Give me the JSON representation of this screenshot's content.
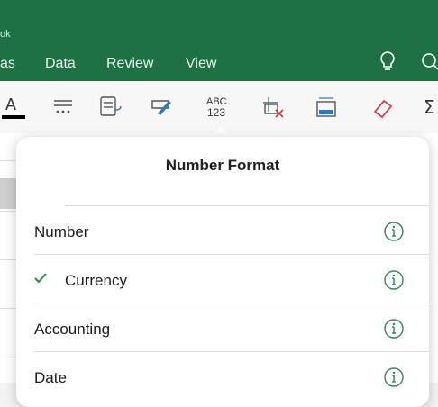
{
  "ribbon": {
    "doc_title": "ok",
    "tabs": [
      "as",
      "Data",
      "Review",
      "View"
    ]
  },
  "toolbar": {
    "tools": [
      {
        "icon": "font-color-icon",
        "glyph": "A"
      },
      {
        "icon": "align-dots-icon"
      },
      {
        "icon": "wrap-text-icon"
      },
      {
        "icon": "format-painter-icon"
      },
      {
        "icon": "number-format-icon",
        "text_top": "ABC",
        "text_bottom": "123"
      },
      {
        "icon": "merge-cells-icon"
      },
      {
        "icon": "autofit-column-icon"
      },
      {
        "icon": "clear-eraser-icon"
      },
      {
        "icon": "autosum-icon",
        "glyph": "Σ"
      }
    ]
  },
  "popover": {
    "title": "Number Format",
    "items": [
      {
        "label": "Number",
        "selected": false
      },
      {
        "label": "Currency",
        "selected": true
      },
      {
        "label": "Accounting",
        "selected": false
      },
      {
        "label": "Date",
        "selected": false
      }
    ]
  },
  "colors": {
    "ribbon_green": "#1e7145",
    "info_green": "#2e8b57",
    "check_green": "#2e8b57"
  }
}
